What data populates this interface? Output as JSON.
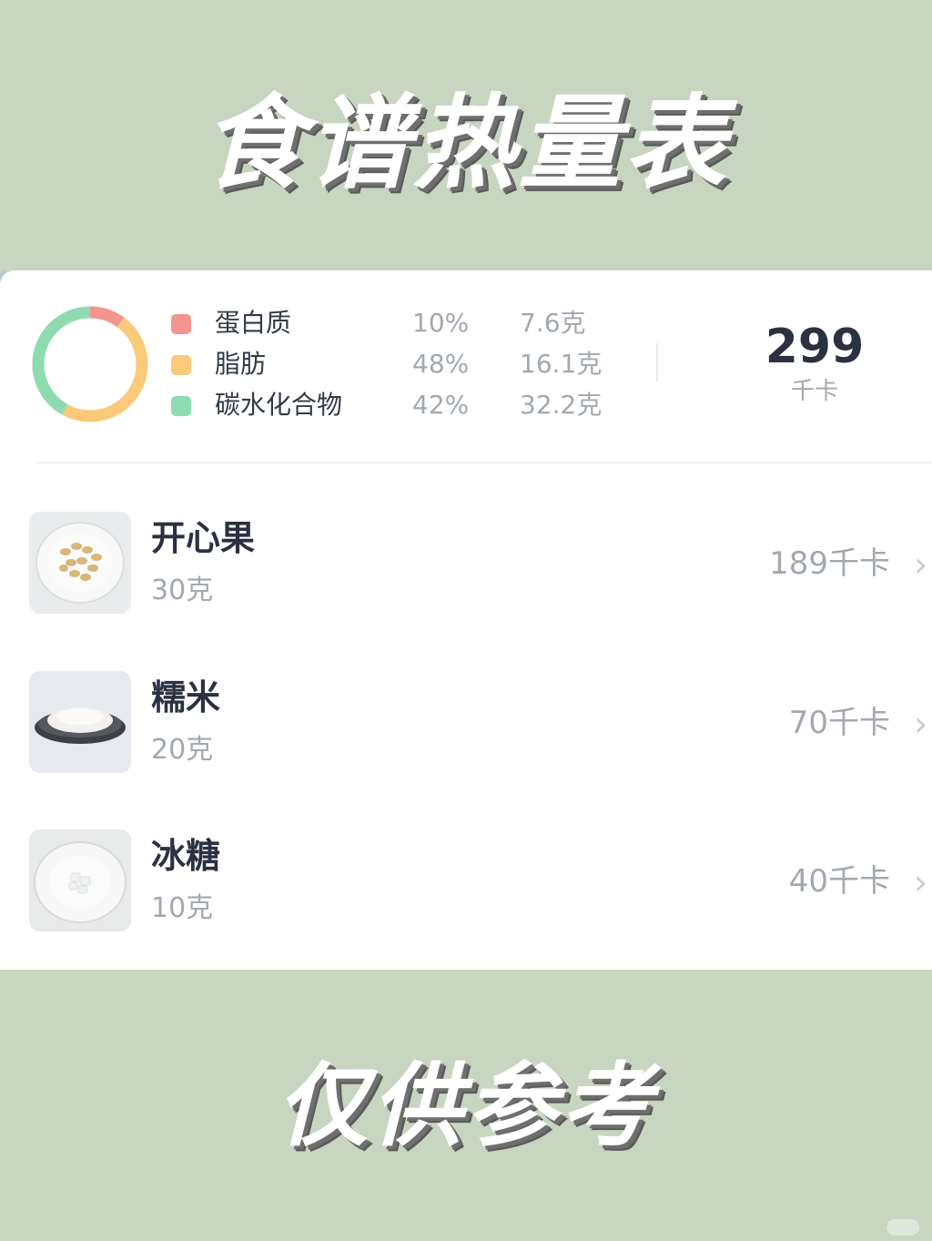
{
  "header": {
    "title": "食谱热量表"
  },
  "footer": {
    "title": "仅供参考"
  },
  "summary": {
    "macros": [
      {
        "name": "蛋白质",
        "percent": "10%",
        "amount": "7.6克",
        "color": "#f2958f",
        "share": 0.1
      },
      {
        "name": "脂肪",
        "percent": "48%",
        "amount": "16.1克",
        "color": "#fbc97a",
        "share": 0.48
      },
      {
        "name": "碳水化合物",
        "percent": "42%",
        "amount": "32.2克",
        "color": "#8edbb0",
        "share": 0.42
      }
    ],
    "total_value": "299",
    "total_unit": "千卡"
  },
  "foods": [
    {
      "name": "开心果",
      "weight": "30克",
      "kcal": "189千卡",
      "icon": "pistachio-plate-icon"
    },
    {
      "name": "糯米",
      "weight": "20克",
      "kcal": "70千卡",
      "icon": "rice-plate-icon"
    },
    {
      "name": "冰糖",
      "weight": "10克",
      "kcal": "40千卡",
      "icon": "rock-sugar-plate-icon"
    }
  ],
  "chevron": "›"
}
